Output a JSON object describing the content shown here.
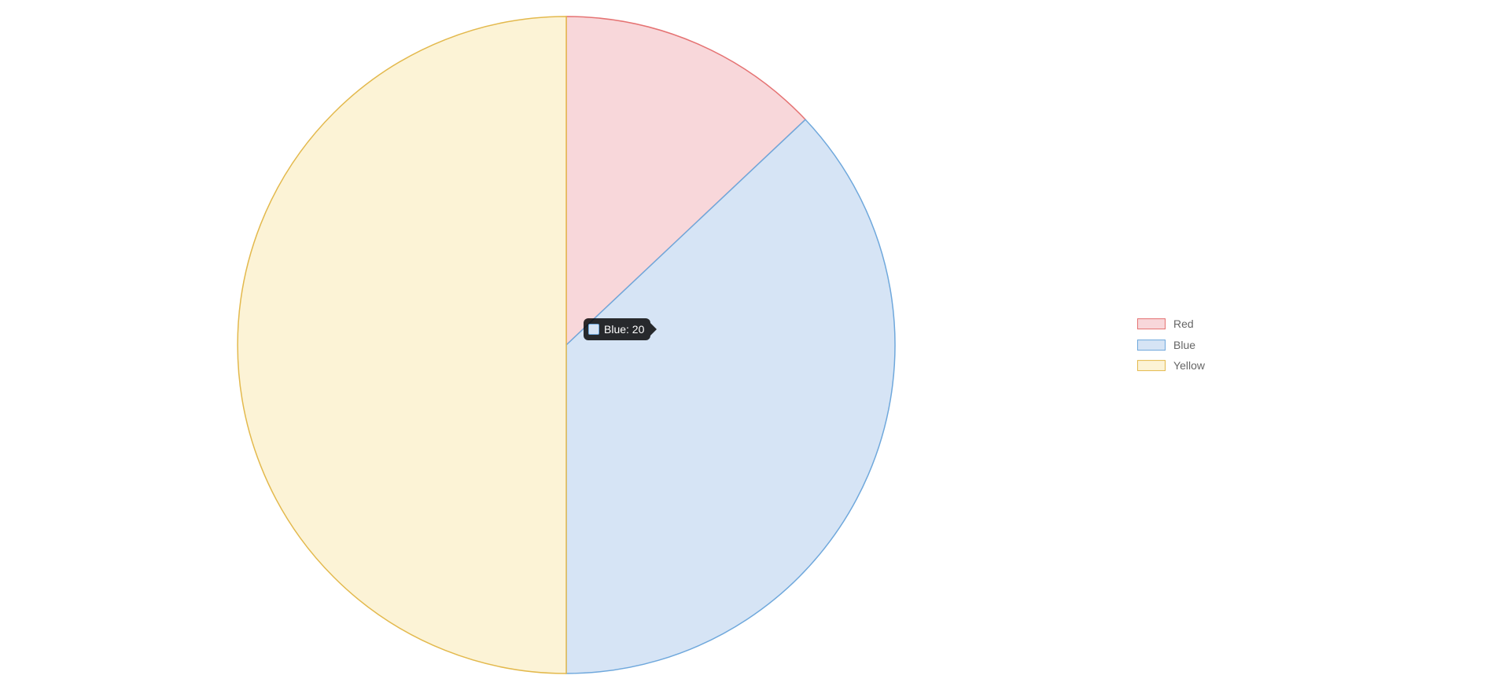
{
  "chart_data": {
    "type": "pie",
    "categories": [
      "Red",
      "Blue",
      "Yellow"
    ],
    "values": [
      7,
      20,
      27
    ],
    "series": [
      {
        "name": "Red",
        "value": 7,
        "fill": "#F8D7DA",
        "stroke": "#E57373"
      },
      {
        "name": "Blue",
        "value": 20,
        "fill": "#D6E4F5",
        "stroke": "#6FA8DC"
      },
      {
        "name": "Yellow",
        "value": 27,
        "fill": "#FCF3D6",
        "stroke": "#E3B94D"
      }
    ],
    "legend_position": "right"
  },
  "legend": {
    "items": [
      {
        "label": "Red",
        "fill": "#F8D7DA",
        "stroke": "#E57373"
      },
      {
        "label": "Blue",
        "fill": "#D6E4F5",
        "stroke": "#6FA8DC"
      },
      {
        "label": "Yellow",
        "fill": "#FCF3D6",
        "stroke": "#E3B94D"
      }
    ]
  },
  "tooltip": {
    "label": "Blue",
    "value": 20,
    "text": "Blue: 20",
    "fill": "#D6E4F5",
    "stroke": "#6FA8DC"
  }
}
